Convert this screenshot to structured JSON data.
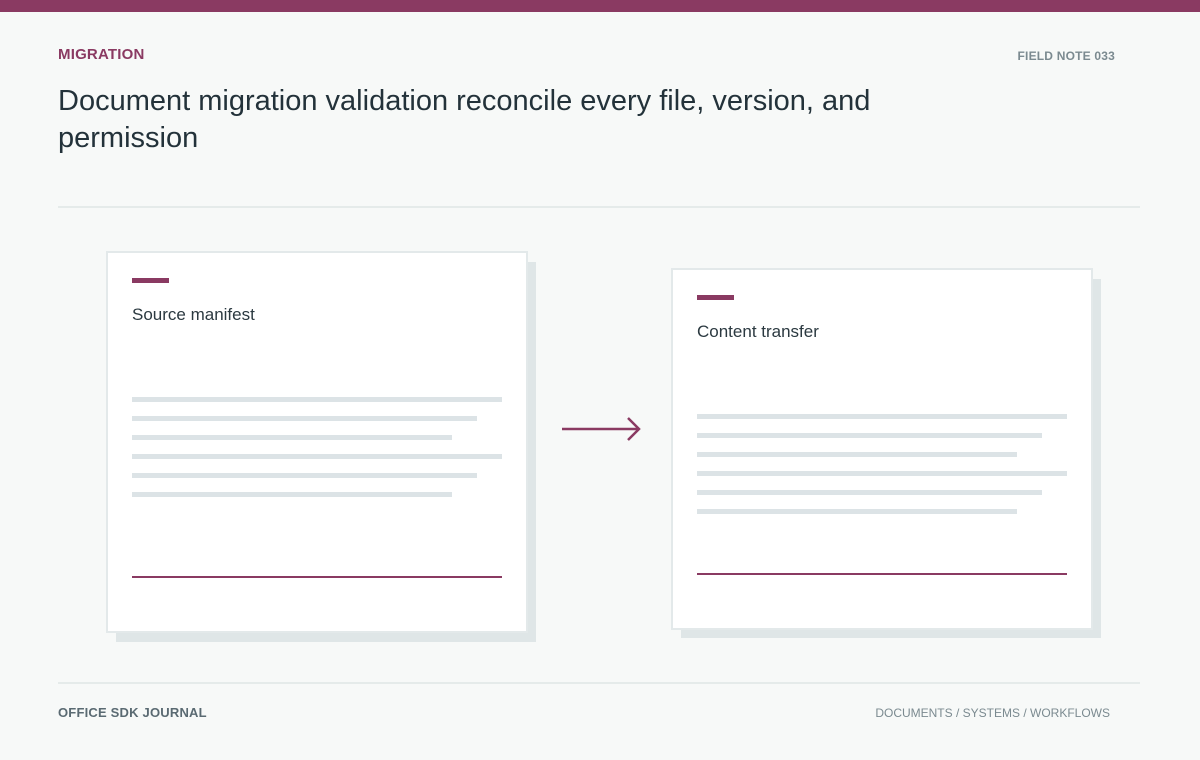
{
  "header": {
    "eyebrow": "MIGRATION",
    "note_id": "FIELD NOTE 033",
    "title": "Document migration validation reconcile every file, version, and permission"
  },
  "cards": [
    {
      "title": "Source manifest"
    },
    {
      "title": "Content transfer"
    }
  ],
  "diagram": {
    "arrow_icon": "arrow-right-icon",
    "accent_color": "#8a3a62"
  },
  "footer": {
    "publication": "OFFICE SDK JOURNAL",
    "categories": "DOCUMENTS / SYSTEMS / WORKFLOWS"
  }
}
